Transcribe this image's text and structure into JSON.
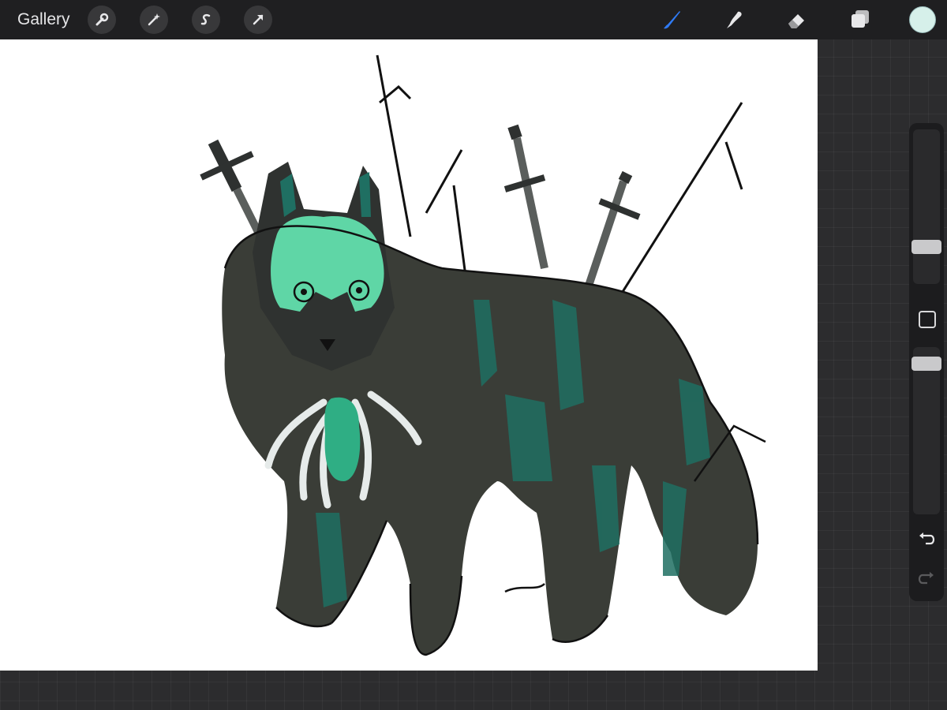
{
  "topbar": {
    "gallery_label": "Gallery",
    "left_tools": [
      {
        "name": "actions-wrench-icon"
      },
      {
        "name": "adjustments-magic-wand-icon"
      },
      {
        "name": "selection-s-icon"
      },
      {
        "name": "transform-arrow-icon"
      }
    ],
    "right_tools": [
      {
        "name": "brush-icon",
        "active": true
      },
      {
        "name": "smudge-icon"
      },
      {
        "name": "eraser-icon"
      },
      {
        "name": "layers-icon"
      }
    ],
    "current_color": "#d6f0ea"
  },
  "colors": {
    "accent": "#2f7bf6",
    "toolbar_bg": "#1f1f21",
    "workspace_bg": "#2c2c2e",
    "canvas_bg": "#ffffff",
    "artwork_fur": "#3a3d37",
    "artwork_teal": "#1f6f62",
    "artwork_mint": "#5fd6a6"
  },
  "sidebar": {
    "controls": [
      "brush-size-slider",
      "modify-square-button",
      "opacity-slider",
      "undo-icon",
      "redo-icon"
    ]
  },
  "canvas": {
    "artwork": "wolf-with-swords-drawing"
  }
}
